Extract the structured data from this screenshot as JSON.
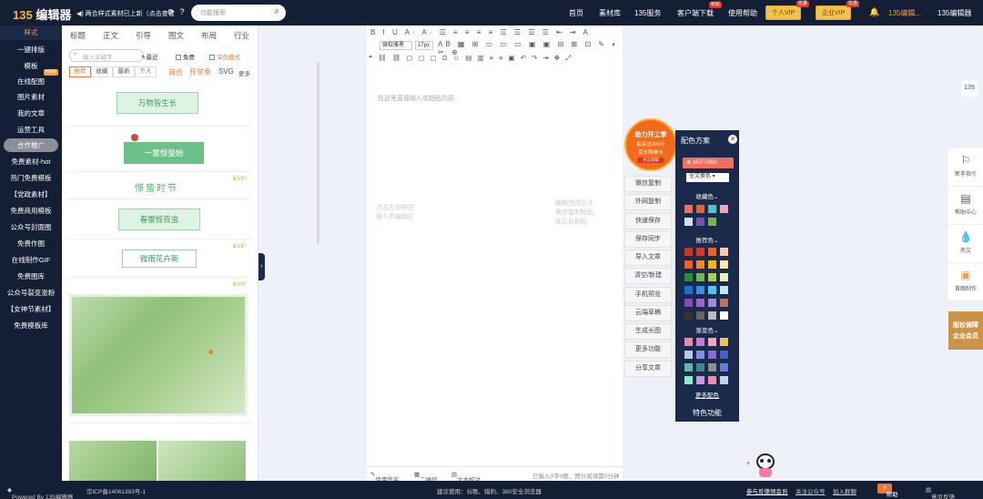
{
  "topbar": {
    "logo_num": "135",
    "logo_text": "编辑器",
    "notice": "两合样式素材已上新（点击查看",
    "search_placeholder": "功能搜索",
    "nav": [
      "首页",
      "素材库",
      "135服务",
      "客户端下载",
      "使用帮助"
    ],
    "nav_badge": "新版",
    "vip_personal": "个人VIP",
    "vip_enterprise": "企业VIP",
    "vip_badge": "优惠",
    "user": "135编辑...",
    "brand": "135编辑器"
  },
  "leftnav": {
    "items": [
      "样式",
      "一键排版",
      "模板",
      "在线配图",
      "图片素材",
      "我的文章",
      "运营工具",
      "合作推广",
      "免费素材-hot",
      "热门免费模板",
      "【党政素材】",
      "免费商用模板",
      "公众号封面图",
      "免费作图",
      "在线制作GIF",
      "免费图库",
      "公众号裂变涨粉",
      "【女神节素材】",
      "免费模板库"
    ],
    "badge": "NEW"
  },
  "panel": {
    "tabs": [
      "标题",
      "正文",
      "引导",
      "图文",
      "布局",
      "行业"
    ],
    "keyword_placeholder": "输入关键字",
    "recent": "最近",
    "free": "免费",
    "dark_mode": "深色模式",
    "filters": [
      "推荐",
      "收藏",
      "最新",
      "个人"
    ],
    "tags": [
      "商合",
      "开学季",
      "SVG",
      "更多"
    ],
    "templates": [
      "万物皆生长",
      "一雷惊蛰始",
      "惊蛰时节",
      "春雷惊百虫",
      "微雨花卉新"
    ],
    "vip_label": "VIP"
  },
  "editor": {
    "font": "微软雅黑",
    "size": "17px",
    "placeholder": "在这里直接输入或粘贴内容",
    "hint_left": [
      "点击左侧样式",
      "插入到编辑区"
    ],
    "hint_right": [
      "编辑完成后点",
      "微信复制粘贴",
      "在后台粘贴"
    ],
    "footer": [
      "使用签名",
      "二维码",
      "文本校对"
    ],
    "count": "已输入0字0图，预计阅读需0分钟"
  },
  "actions": [
    "微信复制",
    "外网复制",
    "快速保存",
    "保存同步",
    "导入文章",
    "清空/新建",
    "手机预览",
    "云端草稿",
    "生成长图",
    "更多功能",
    "分享文章"
  ],
  "promo": {
    "title": "助力开工季",
    "line2": "最高送300元",
    "line3": "京东购物卡",
    "btn": "点击领取"
  },
  "colorpanel": {
    "title": "配色方案",
    "hex": "#EF7060",
    "mode": "全文换色",
    "fav": "收藏色",
    "rec": "推荐色",
    "grad": "渐变色",
    "more": "更多配色",
    "special": "特色功能",
    "fav_colors": [
      "#ef7060",
      "#e8632a",
      "#4fc3c9",
      "#f4a5b5",
      "#cfe2f3",
      "#7b4fb8",
      "#7ab24f"
    ],
    "rec_colors": [
      "#c0392b",
      "#d63a2f",
      "#e8632a",
      "#f7c6b6",
      "#e8632a",
      "#f08a24",
      "#f5b622",
      "#fbe7a1",
      "#2e8b3a",
      "#7ab24f",
      "#a8cf5a",
      "#e6f2b8",
      "#1f6fd1",
      "#3a8ee6",
      "#4fc3f7",
      "#bfe6fb",
      "#7b4fb8",
      "#a066c8",
      "#9c8cd1",
      "#b5735a",
      "#333333",
      "#666666",
      "#bbbbbb",
      "#ffffff"
    ],
    "grad_colors": [
      "#e88aa8",
      "#c77dd8",
      "#f0a8b8",
      "#f5c542",
      "#b8c4f0",
      "#7f8fe8",
      "#8a6bd8",
      "#3a66c9",
      "#5fb8a8",
      "#3a8a8a",
      "#8a8f99",
      "#5f7fd8",
      "#8af0c0",
      "#c79ae8",
      "#f08ab0",
      "#b8d8f0"
    ]
  },
  "rightrail": [
    {
      "icon": "guide-icon",
      "label": "新手指引"
    },
    {
      "icon": "help-center-icon",
      "label": "帮助中心"
    },
    {
      "icon": "drop-icon",
      "label": "热文"
    },
    {
      "icon": "image-icon",
      "label": "首图制作"
    }
  ],
  "copyright_badge": [
    "版权保障",
    "企业会员"
  ],
  "bottombar": {
    "powered": "Powered By 135编辑器",
    "icp": "京ICP备14061383号-1",
    "browsers": "建议使用：谷歌、猎豹、360安全浏览器",
    "join": "参与反馈领会员",
    "follow": "关注公众号",
    "group": "加入群聊",
    "help": "帮助",
    "feedback": "意见反馈"
  }
}
